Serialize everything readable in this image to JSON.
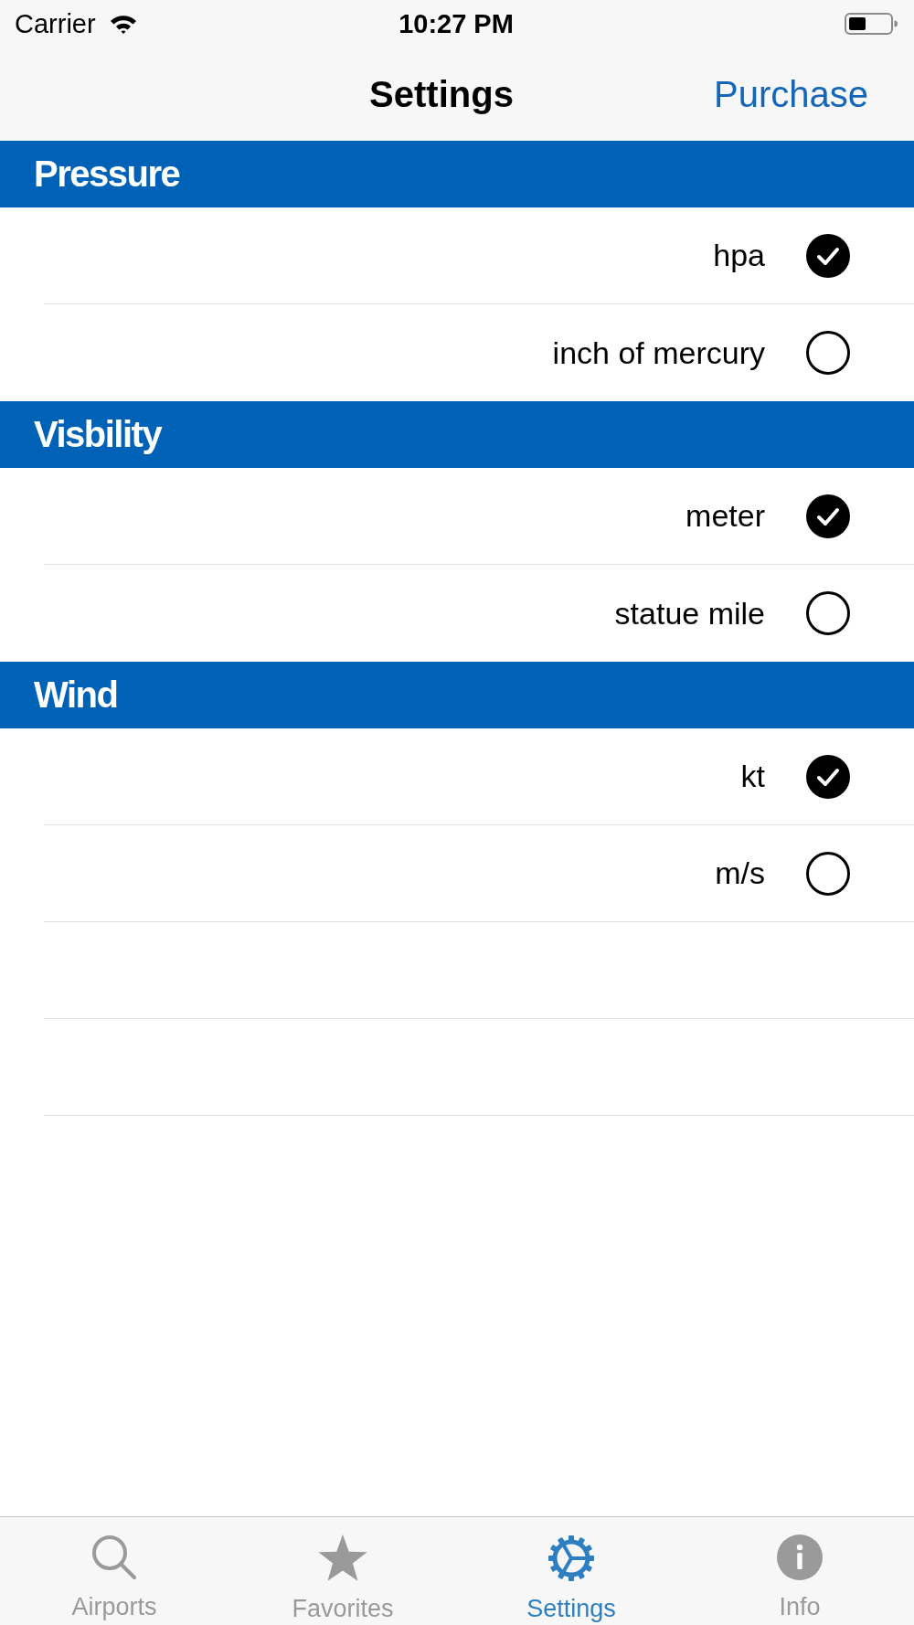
{
  "status_bar": {
    "carrier": "Carrier",
    "time": "10:27 PM"
  },
  "nav_bar": {
    "title": "Settings",
    "right_button": "Purchase"
  },
  "sections": [
    {
      "title": "Pressure",
      "options": [
        {
          "label": "hpa",
          "selected": true
        },
        {
          "label": "inch of mercury",
          "selected": false
        }
      ]
    },
    {
      "title": "Visbility",
      "options": [
        {
          "label": "meter",
          "selected": true
        },
        {
          "label": "statue mile",
          "selected": false
        }
      ]
    },
    {
      "title": "Wind",
      "options": [
        {
          "label": "kt",
          "selected": true
        },
        {
          "label": "m/s",
          "selected": false
        }
      ]
    }
  ],
  "tab_bar": [
    {
      "label": "Airports",
      "selected": false
    },
    {
      "label": "Favorites",
      "selected": false
    },
    {
      "label": "Settings",
      "selected": true
    },
    {
      "label": "Info",
      "selected": false
    }
  ]
}
